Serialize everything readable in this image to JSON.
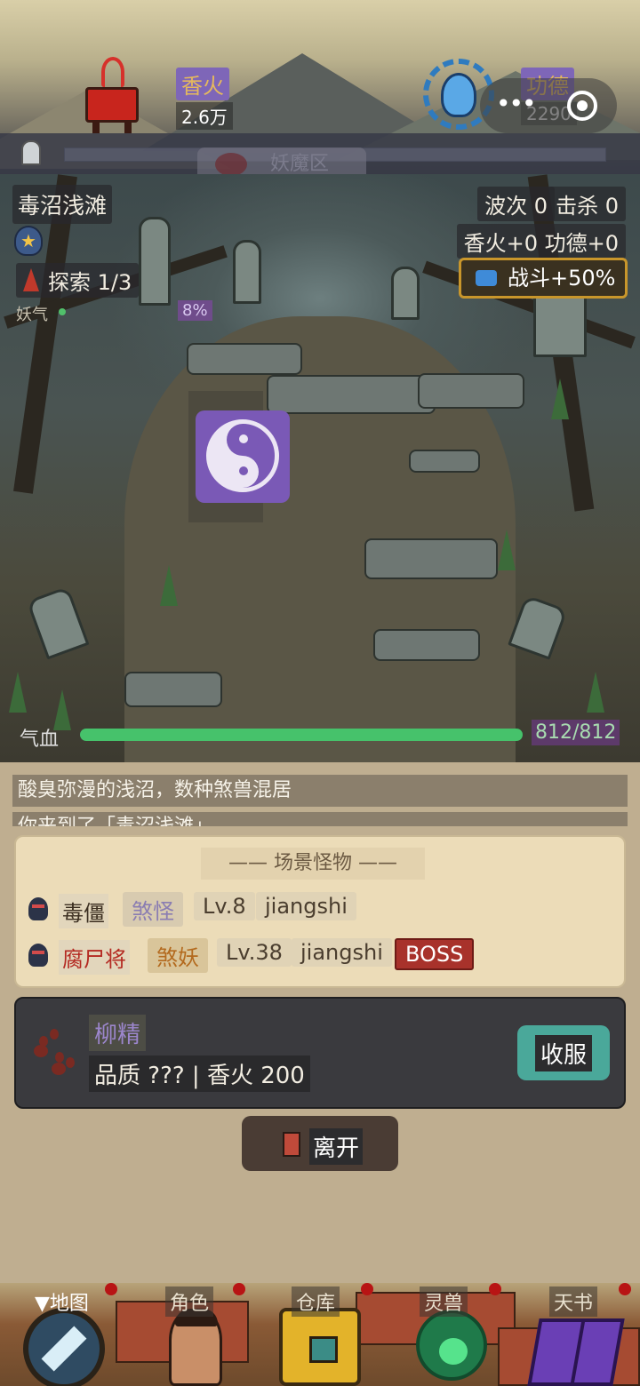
{
  "header": {
    "xianghuo": {
      "label": "香火",
      "value": "2.6万"
    },
    "gongde": {
      "label": "功德",
      "value": "2290"
    },
    "zone_tab": "妖魔区",
    "icons": {
      "censer": "incense-burner-icon",
      "lotus": "lotus-icon",
      "more": "more-dots-icon",
      "close": "target-close-icon",
      "zone": "tombstone-icon"
    }
  },
  "scene": {
    "location": "毒沼浅滩",
    "explore": "探索 1/3",
    "yaoqi_label": "妖气",
    "yaoqi_pct": "8%",
    "wave": "波次 0",
    "kill": "击杀 0",
    "gains": "香火+0 功德+0",
    "battle_boost": "战斗+50%",
    "hp_label": "气血",
    "hp_value": "812/812",
    "hp_fraction": 1.0
  },
  "log": [
    "酸臭弥漫的浅沼，数种煞兽混居",
    "你来到了「毒沼浅滩」"
  ],
  "monsters": {
    "title": "—— 场景怪物 ——",
    "rows": [
      {
        "name": "毒僵",
        "kind": "煞怪",
        "level": "Lv.8",
        "type": "jiangshi",
        "badge": ""
      },
      {
        "name": "腐尸将",
        "kind": "煞妖",
        "level": "Lv.38",
        "type": "jiangshi",
        "badge": "BOSS"
      }
    ]
  },
  "recruit": {
    "name": "柳精",
    "info": "品质 ??? | 香火 200",
    "button": "收服"
  },
  "leave_button": "离开",
  "nav": [
    {
      "label": "▼地图",
      "icon": "compass-icon"
    },
    {
      "label": "角色",
      "icon": "hero-portrait-icon"
    },
    {
      "label": "仓库",
      "icon": "treasure-chest-icon"
    },
    {
      "label": "灵兽",
      "icon": "beast-paw-icon"
    },
    {
      "label": "天书",
      "icon": "spell-book-icon"
    }
  ],
  "colors": {
    "accent_purple": "#7a59b6",
    "hp_green": "#46c26b",
    "boss_red": "#a8322b",
    "recruit_teal": "#4aa89a"
  }
}
